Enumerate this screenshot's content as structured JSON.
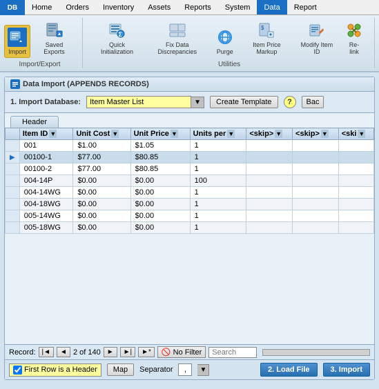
{
  "app": {
    "logo": "DB"
  },
  "nav": {
    "items": [
      {
        "label": "Home",
        "active": false
      },
      {
        "label": "Orders",
        "active": false
      },
      {
        "label": "Inventory",
        "active": false
      },
      {
        "label": "Assets",
        "active": false
      },
      {
        "label": "Reports",
        "active": false
      },
      {
        "label": "System",
        "active": false
      },
      {
        "label": "Data",
        "active": true
      },
      {
        "label": "Report",
        "active": false
      }
    ]
  },
  "ribbon": {
    "groups": [
      {
        "label": "Import/Export",
        "buttons": [
          {
            "label": "Import",
            "active": true
          },
          {
            "label": "Saved Exports",
            "active": false
          }
        ]
      },
      {
        "label": "Utilities",
        "buttons": [
          {
            "label": "Quick Initialization",
            "active": false
          },
          {
            "label": "Fix Data Discrepancies",
            "active": false
          },
          {
            "label": "Purge",
            "active": false
          },
          {
            "label": "Item Price Markup",
            "active": false
          },
          {
            "label": "Modify Item ID",
            "active": false
          },
          {
            "label": "Re-link",
            "active": false
          }
        ]
      }
    ]
  },
  "panel": {
    "title": "Data Import (APPENDS RECORDS)",
    "import_database_label": "1. Import Database:",
    "dropdown_value": "Item Master List",
    "create_template_btn": "Create Template",
    "back_btn": "Bac",
    "header_tab": "Header"
  },
  "table": {
    "columns": [
      {
        "label": "Item ID",
        "has_filter": true
      },
      {
        "label": "Unit Cost",
        "has_filter": true
      },
      {
        "label": "Unit Price",
        "has_filter": true
      },
      {
        "label": "Units per",
        "has_filter": true
      },
      {
        "label": "<skip>",
        "has_filter": true
      },
      {
        "label": "<skip>",
        "has_filter": true
      },
      {
        "label": "<ski",
        "has_filter": true
      }
    ],
    "rows": [
      {
        "marker": "",
        "item_id": "001",
        "unit_cost": "$1.00",
        "unit_price": "$1.05",
        "units_per": "1",
        "skip1": "",
        "skip2": "",
        "skip3": "",
        "active": false
      },
      {
        "marker": "▶",
        "item_id": "00100-1",
        "unit_cost": "$77.00",
        "unit_price": "$80.85",
        "units_per": "1",
        "skip1": "",
        "skip2": "",
        "skip3": "",
        "active": true
      },
      {
        "marker": "",
        "item_id": "00100-2",
        "unit_cost": "$77.00",
        "unit_price": "$80.85",
        "units_per": "1",
        "skip1": "",
        "skip2": "",
        "skip3": "",
        "active": false
      },
      {
        "marker": "",
        "item_id": "004-14P",
        "unit_cost": "$0.00",
        "unit_price": "$0.00",
        "units_per": "100",
        "skip1": "",
        "skip2": "",
        "skip3": "",
        "active": false
      },
      {
        "marker": "",
        "item_id": "004-14WG",
        "unit_cost": "$0.00",
        "unit_price": "$0.00",
        "units_per": "1",
        "skip1": "",
        "skip2": "",
        "skip3": "",
        "active": false
      },
      {
        "marker": "",
        "item_id": "004-18WG",
        "unit_cost": "$0.00",
        "unit_price": "$0.00",
        "units_per": "1",
        "skip1": "",
        "skip2": "",
        "skip3": "",
        "active": false
      },
      {
        "marker": "",
        "item_id": "005-14WG",
        "unit_cost": "$0.00",
        "unit_price": "$0.00",
        "units_per": "1",
        "skip1": "",
        "skip2": "",
        "skip3": "",
        "active": false
      },
      {
        "marker": "",
        "item_id": "005-18WG",
        "unit_cost": "$0.00",
        "unit_price": "$0.00",
        "units_per": "1",
        "skip1": "",
        "skip2": "",
        "skip3": "",
        "active": false
      }
    ]
  },
  "record_nav": {
    "label": "Record:",
    "first_btn": "|◄",
    "prev_btn": "◄",
    "record_info": "2 of 140",
    "next_btn": "►",
    "last_btn": "►|",
    "extra_btn": "►*",
    "no_filter_btn": "No Filter",
    "search_placeholder": "Search"
  },
  "bottom_bar": {
    "first_row_checkbox_label": "First Row is a Header",
    "map_btn": "Map",
    "separator_label": "Separator",
    "separator_value": ",",
    "load_file_btn": "2. Load File",
    "import_btn": "3. Import"
  }
}
